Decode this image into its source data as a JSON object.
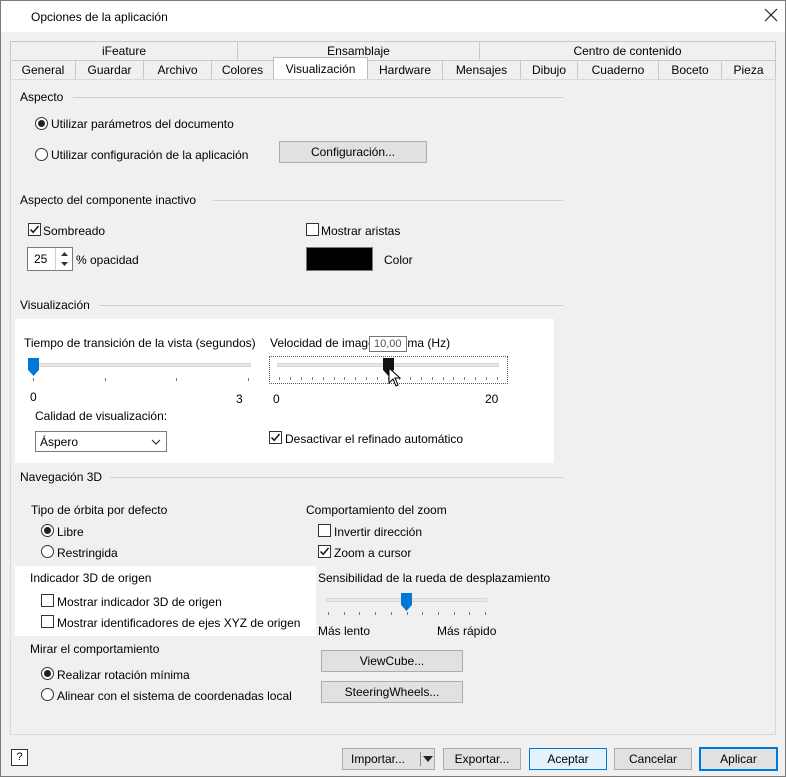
{
  "window": {
    "title": "Opciones de la aplicación"
  },
  "tabs": {
    "row1": [
      {
        "label": "iFeature"
      },
      {
        "label": "Ensamblaje"
      },
      {
        "label": "Centro de contenido"
      }
    ],
    "row2": [
      {
        "label": "General"
      },
      {
        "label": "Guardar"
      },
      {
        "label": "Archivo"
      },
      {
        "label": "Colores"
      },
      {
        "label": "Visualización"
      },
      {
        "label": "Hardware"
      },
      {
        "label": "Mensajes"
      },
      {
        "label": "Dibujo"
      },
      {
        "label": "Cuaderno"
      },
      {
        "label": "Boceto"
      },
      {
        "label": "Pieza"
      }
    ],
    "active": "Visualización"
  },
  "aspecto": {
    "heading": "Aspecto",
    "opt_document": "Utilizar parámetros del documento",
    "opt_app": "Utilizar configuración de la aplicación",
    "config_button": "Configuración..."
  },
  "inactivo": {
    "heading": "Aspecto del componente inactivo",
    "sombreado": "Sombreado",
    "mostrar_aristas": "Mostrar aristas",
    "opacity_value": "25",
    "opacity_label": "% opacidad",
    "color_label": "Color",
    "color_value": "#000000"
  },
  "visualizacion": {
    "heading": "Visualización",
    "transition_label": "Tiempo de transición de la vista (segundos)",
    "transition_min": "0",
    "transition_max": "3",
    "transition_value": 0,
    "fps_label": "Velocidad de imagen mínima (Hz)",
    "fps_min": "0",
    "fps_max": "20",
    "fps_value": 10,
    "fps_tooltip": "10,00",
    "calidad_label": "Calidad de visualización:",
    "calidad_value": "Áspero",
    "refinado_label": "Desactivar el refinado automático"
  },
  "nav3d": {
    "heading": "Navegación 3D",
    "orbit_heading": "Tipo de órbita por defecto",
    "orbit_libre": "Libre",
    "orbit_restringida": "Restringida",
    "zoom_heading": "Comportamiento del zoom",
    "zoom_invertir": "Invertir dirección",
    "zoom_cursor": "Zoom a cursor",
    "wheel_label": "Sensibilidad de la rueda de desplazamiento",
    "wheel_slow": "Más lento",
    "wheel_fast": "Más rápido",
    "wheel_value": 0.5,
    "origin_heading": "Indicador 3D de origen",
    "origin_show": "Mostrar indicador 3D de origen",
    "origin_xyz": "Mostrar identificadores de ejes XYZ de origen",
    "mirar_heading": "Mirar el comportamiento",
    "mirar_min": "Realizar rotación mínima",
    "mirar_align": "Alinear con el sistema de coordenadas local",
    "viewcube_button": "ViewCube...",
    "steering_button": "SteeringWheels..."
  },
  "footer": {
    "help": "?",
    "importar": "Importar...",
    "exportar": "Exportar...",
    "aceptar": "Aceptar",
    "cancelar": "Cancelar",
    "aplicar": "Aplicar"
  }
}
